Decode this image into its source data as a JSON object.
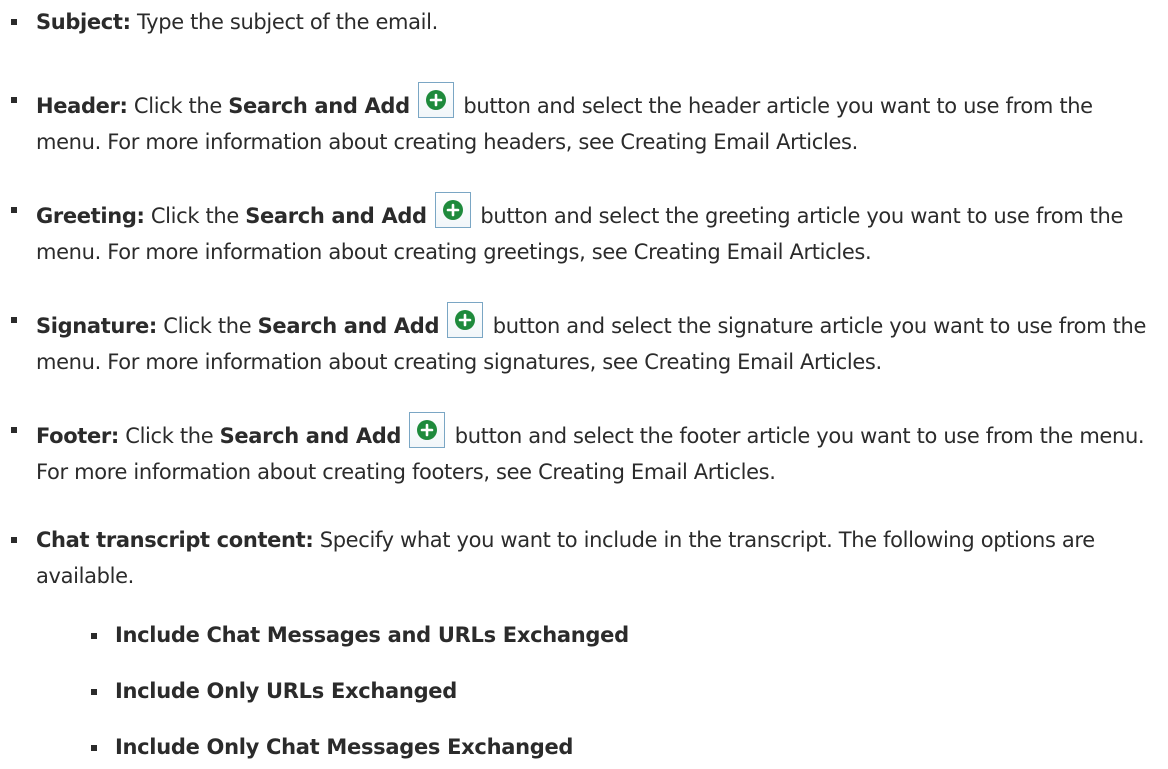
{
  "items": [
    {
      "term": "Subject:",
      "text": " Type the subject of the email."
    },
    {
      "term": "Header:",
      "pre": " Click the ",
      "bold": "Search and Add",
      "post": " button and select the header article you want to use from the menu. For more information about creating headers, see Creating Email Articles."
    },
    {
      "term": "Greeting:",
      "pre": " Click the ",
      "bold": "Search and Add",
      "post": " button and select the greeting article you want to use from the menu. For more information about creating greetings, see Creating Email Articles."
    },
    {
      "term": "Signature:",
      "pre": " Click the ",
      "bold": "Search and Add",
      "post": " button and select the signature article you want to use from the menu. For more information about creating signatures, see Creating Email Articles."
    },
    {
      "term": "Footer:",
      "pre": " Click the ",
      "bold": "Search and Add",
      "post": " button and select the footer article you want to use from the menu. For more information about creating footers, see Creating Email Articles."
    },
    {
      "term": "Chat transcript content:",
      "text": " Specify what you want to include in the transcript. The following options are available."
    }
  ],
  "sub_items": [
    "Include Chat Messages and URLs Exchanged",
    "Include Only URLs Exchanged",
    "Include Only Chat Messages Exchanged"
  ],
  "icons": {
    "add_button_icon": "plus-circle-icon",
    "add_color": "#1e8a3c",
    "bullet_color": "#2b2b2b"
  }
}
